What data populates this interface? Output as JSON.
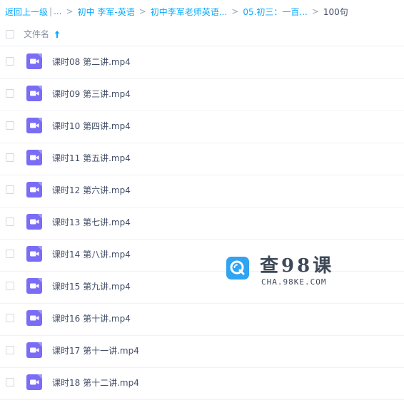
{
  "breadcrumb": {
    "back": "返回上一级",
    "separator": "|",
    "ellipsis": "...",
    "arrow": ">",
    "items": [
      "初中 李军-英语",
      "初中李军老师英语...",
      "05.初三：一百..."
    ],
    "current": "100句"
  },
  "table_header": {
    "name_label": "文件名",
    "sort_icon": "arrow-up-icon"
  },
  "files": [
    "课时08 第二讲.mp4",
    "课时09 第三讲.mp4",
    "课时10 第四讲.mp4",
    "课时11 第五讲.mp4",
    "课时12 第六讲.mp4",
    "课时13 第七讲.mp4",
    "课时14 第八讲.mp4",
    "课时15 第九讲.mp4",
    "课时16 第十讲.mp4",
    "课时17 第十一讲.mp4",
    "课时18 第十二讲.mp4"
  ],
  "file_icon": "video-file-icon",
  "watermark": {
    "title": "查98课",
    "subtitle": "CHA.98KE.COM"
  },
  "colors": {
    "link": "#09aaff",
    "video_icon": "#7b6cf6",
    "watermark_logo": "#1f9cf0"
  }
}
